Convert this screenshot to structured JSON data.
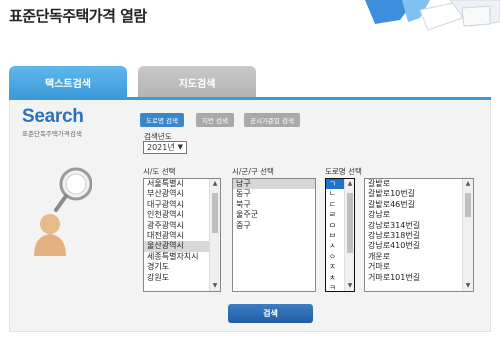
{
  "page": {
    "title": "표준단독주택가격 열람"
  },
  "tabs": [
    {
      "label": "텍스트검색",
      "active": true
    },
    {
      "label": "지도검색",
      "active": false
    }
  ],
  "panel": {
    "logo_title": "Search",
    "logo_subtitle": "표준단독주택가격검색",
    "modes": [
      {
        "label": "도로명 검색",
        "active": true
      },
      {
        "label": "지번 검색",
        "active": false
      },
      {
        "label": "공시기준일 검색",
        "active": false
      }
    ],
    "year": {
      "label": "검색년도",
      "value": "2021년"
    },
    "sido": {
      "label": "시/도 선택",
      "selected": "울산광역시",
      "items": [
        "서울특별시",
        "부산광역시",
        "대구광역시",
        "인천광역시",
        "광주광역시",
        "대전광역시",
        "울산광역시",
        "세종특별자치시",
        "경기도",
        "강원도"
      ]
    },
    "sigungu": {
      "label": "시/군/구 선택",
      "selected": "남구",
      "items": [
        "남구",
        "동구",
        "북구",
        "울주군",
        "중구"
      ]
    },
    "road": {
      "label": "도로명 선택",
      "initials_selected": "ㄱ",
      "initials": [
        "ㄱ",
        "ㄴ",
        "ㄷ",
        "ㄹ",
        "ㅁ",
        "ㅂ",
        "ㅅ",
        "ㅇ",
        "ㅈ",
        "ㅊ",
        "ㅋ"
      ],
      "items": [
        "갈밭로",
        "갈밭로10번길",
        "갈밭로46번길",
        "강남로",
        "강남로314번길",
        "강남로318번길",
        "강남로410번길",
        "개운로",
        "거마로",
        "거마로101번길"
      ]
    },
    "search_button": "검색"
  },
  "colors": {
    "accent": "#3b9ad9",
    "button": "#1f5ea5",
    "selected_initial": "#1e74c9"
  }
}
